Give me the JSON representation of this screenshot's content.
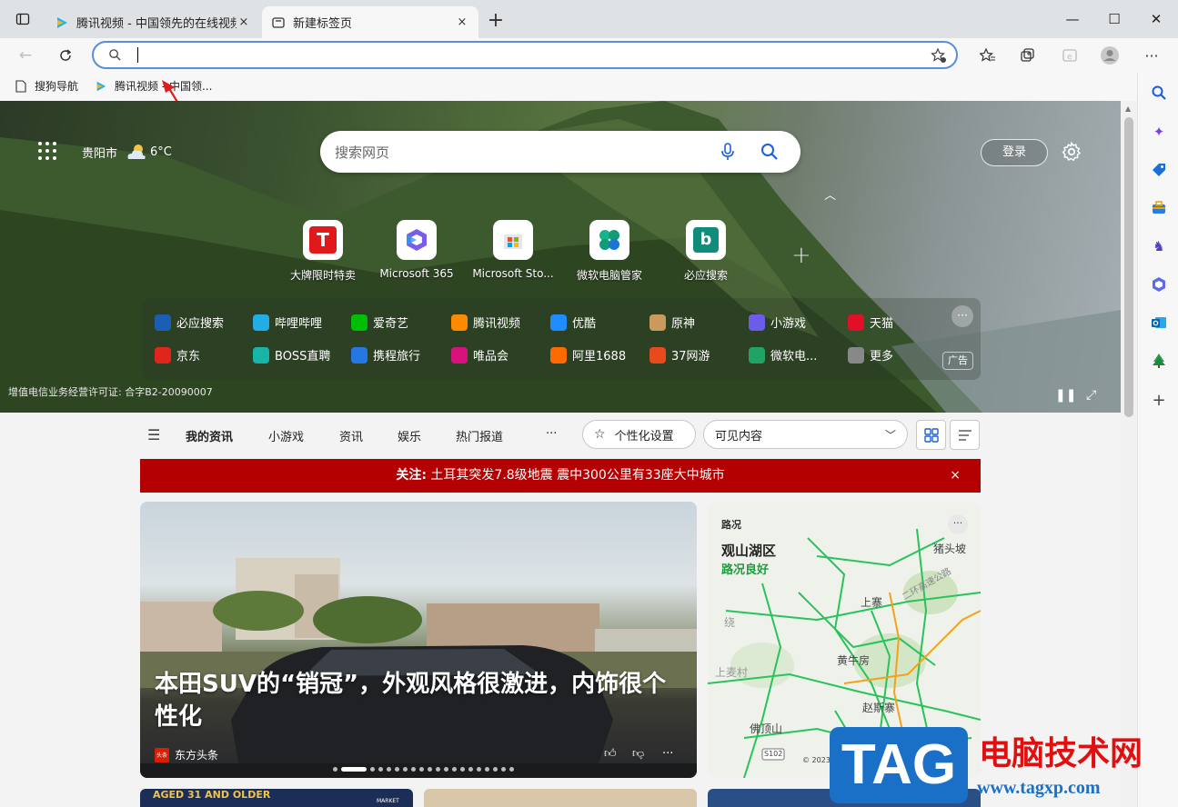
{
  "browser": {
    "tabs": [
      {
        "title": "腾讯视频 - 中国领先的在线视频媒",
        "close": "×"
      },
      {
        "title": "新建标签页",
        "close": "×"
      }
    ],
    "new_tab": "+",
    "address_value": "",
    "bookmarks": [
      {
        "label": "搜狗导航"
      },
      {
        "label": "腾讯视频 - 中国领..."
      }
    ]
  },
  "newtab": {
    "city": "贵阳市",
    "temperature": "6°C",
    "search_placeholder": "搜索网页",
    "login": "登录",
    "tiles": [
      {
        "label": "大牌限时特卖"
      },
      {
        "label": "Microsoft 365"
      },
      {
        "label": "Microsoft Sto..."
      },
      {
        "label": "微软电脑管家"
      },
      {
        "label": "必应搜索"
      }
    ],
    "links_row1": [
      {
        "label": "必应搜索",
        "color": "#1a5fb4"
      },
      {
        "label": "哔哩哔哩",
        "color": "#23ade5"
      },
      {
        "label": "爱奇艺",
        "color": "#00be06"
      },
      {
        "label": "腾讯视频",
        "color": "#ff8a00"
      },
      {
        "label": "优酷",
        "color": "#1f8cff"
      },
      {
        "label": "原神",
        "color": "#c99a5b"
      },
      {
        "label": "小游戏",
        "color": "#6c5ce7"
      },
      {
        "label": "天猫",
        "color": "#e0102a"
      }
    ],
    "links_row2": [
      {
        "label": "京东",
        "color": "#e1251b"
      },
      {
        "label": "BOSS直聘",
        "color": "#18b4a8"
      },
      {
        "label": "携程旅行",
        "color": "#2577e3"
      },
      {
        "label": "唯品会",
        "color": "#d8127d"
      },
      {
        "label": "阿里1688",
        "color": "#ff6a00"
      },
      {
        "label": "37网游",
        "color": "#e8491d"
      },
      {
        "label": "微软电...",
        "color": "#21a366"
      },
      {
        "label": "更多",
        "color": "#888888"
      }
    ],
    "ad": "广告",
    "license": "增值电信业务经营许可证: 合字B2-20090007"
  },
  "feed": {
    "nav": [
      "我的资讯",
      "小游戏",
      "资讯",
      "娱乐",
      "热门报道",
      "···"
    ],
    "personalize": "个性化设置",
    "visible_content": "可见内容",
    "alert_prefix": "关注:",
    "alert_text": "土耳其突发7.8级地震 震中300公里有33座大中城市",
    "alert_close": "×",
    "headline": "本田SUV的“销冠”，外观风格很激进，内饰很个性化",
    "source": "东方头条",
    "source_icon": "头条"
  },
  "traffic": {
    "title": "路况",
    "area": "观山湖区",
    "status": "路况良好",
    "labels": [
      "猪头坡",
      "上寨",
      "黄牛房",
      "赵斯寨",
      "佛顶山",
      "上麦村",
      "S102",
      "© 2023",
      "二环高速公路",
      "绕"
    ]
  },
  "bottom_cards": [
    {
      "text": "AGED 31 AND OLDER"
    },
    {
      "text": "MARKET"
    }
  ],
  "watermark": {
    "logo": "TAG",
    "name": "电脑技术网",
    "url": "www.tagxp.com"
  },
  "colors": {
    "accent": "#5a8ddc",
    "alert": "#b40000",
    "traffic_good": "#1a9e3a"
  }
}
